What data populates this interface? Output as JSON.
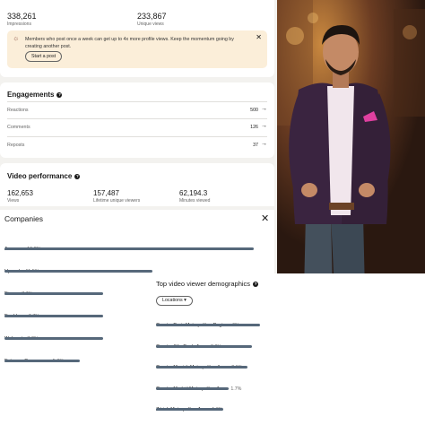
{
  "top_stats": {
    "impressions": {
      "value": "338,261",
      "label": "Impressions"
    },
    "unique_views": {
      "value": "233,867",
      "label": "Unique views"
    }
  },
  "nudge": {
    "text": "Members who post once a week can get up to 4x more profile views. Keep the momentum going by creating another post.",
    "button": "Start a post"
  },
  "engagements": {
    "title": "Engagements",
    "rows": [
      {
        "label": "Reactions",
        "value": "500"
      },
      {
        "label": "Comments",
        "value": "126"
      },
      {
        "label": "Reposts",
        "value": "37"
      }
    ]
  },
  "video": {
    "title": "Video performance",
    "stats": [
      {
        "value": "162,653",
        "label": "Views"
      },
      {
        "value": "157,487",
        "label": "Lifetime unique viewers"
      },
      {
        "value": "62,194.3",
        "label": "Minutes viewed"
      }
    ]
  },
  "companies": {
    "title": "Companies",
    "items": [
      {
        "name": "Amazon",
        "pct": "19.2%",
        "fill": 0.96
      },
      {
        "name": "Upwork",
        "pct": "11.5%",
        "fill": 0.57
      },
      {
        "name": "Fiverr",
        "pct": "7.7%",
        "fill": 0.38
      },
      {
        "name": "Enablers",
        "pct": "7.7%",
        "fill": 0.38
      },
      {
        "name": "Walmart",
        "pct": "7.7%",
        "fill": 0.38
      },
      {
        "name": "Extreme Commerce",
        "pct": "5.8%",
        "fill": 0.29
      }
    ]
  },
  "demographics": {
    "title": "Top video viewer demographics",
    "filter": "Locations",
    "items": [
      {
        "name": "Greater Paris Metropolitan Region",
        "pct": "6%",
        "fill": 0.4
      },
      {
        "name": "Greater São Paulo Area",
        "pct": "2.2%",
        "fill": 0.37
      },
      {
        "name": "Greater Munich Metropolitan Area",
        "pct": "2.1%",
        "fill": 0.35
      },
      {
        "name": "Greater Madrid Metropolitan Area",
        "pct": "1.7%",
        "fill": 0.28
      },
      {
        "name": "Zürich Metropolitan Area",
        "pct": "1.6%",
        "fill": 0.26
      }
    ]
  },
  "colors": {
    "bar": "#56687a",
    "nudge_bg": "#fbeed9",
    "page_bg": "#f3f2ef"
  },
  "icons": [
    "lightbulb-icon",
    "close-icon",
    "help-icon",
    "arrow-right-icon",
    "chevron-down-icon"
  ]
}
